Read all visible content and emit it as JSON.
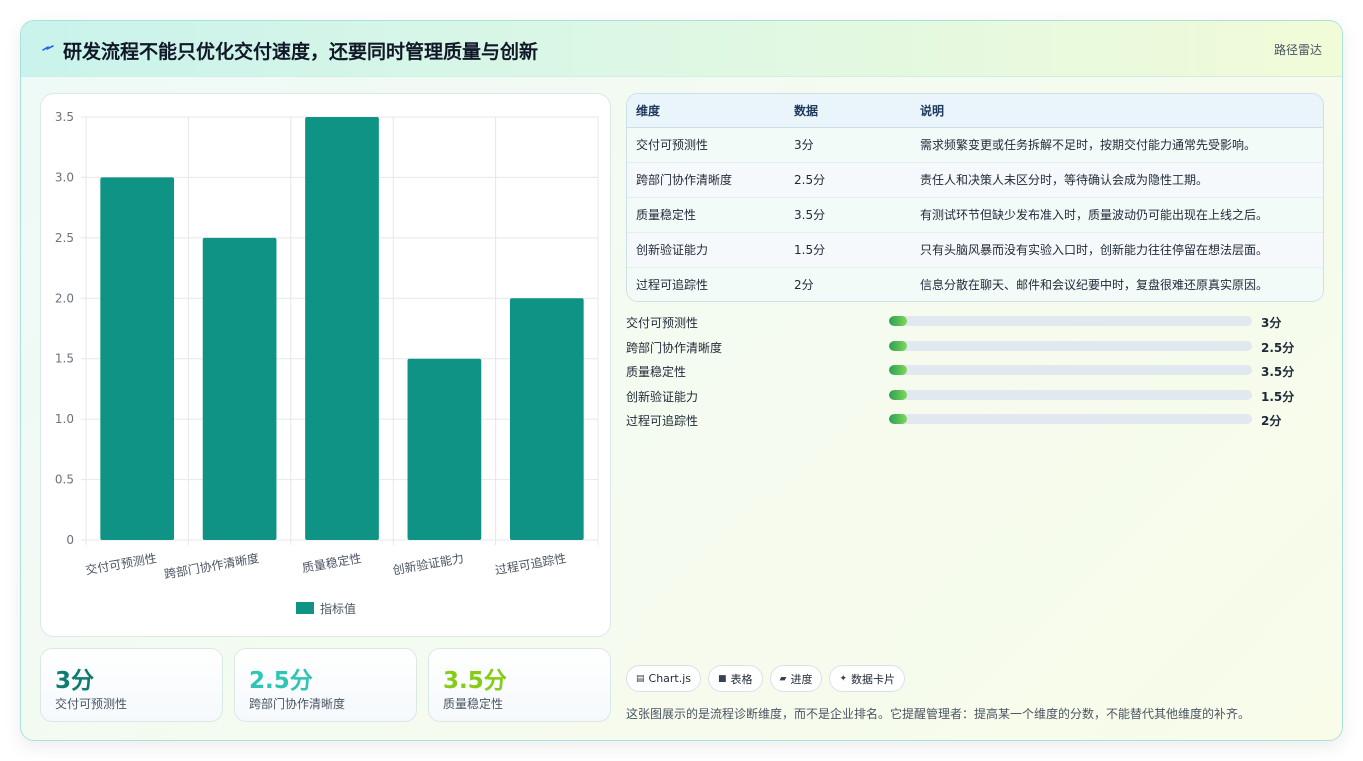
{
  "header": {
    "title": "研发流程不能只优化交付速度，还要同时管理质量与创新",
    "tag": "路径雷达"
  },
  "chart_data": {
    "type": "bar",
    "categories": [
      "交付可预测性",
      "跨部门协作清晰度",
      "质量稳定性",
      "创新验证能力",
      "过程可追踪性"
    ],
    "series": [
      {
        "name": "指标值",
        "values": [
          3,
          2.5,
          3.5,
          1.5,
          2
        ]
      }
    ],
    "ylim": [
      0,
      3.5
    ],
    "yticks": [
      "0",
      "0.5",
      "1.0",
      "1.5",
      "2.0",
      "2.5",
      "3.0",
      "3.5"
    ],
    "legend": "bottom",
    "grid": true,
    "color": "#0e9384"
  },
  "kpis": [
    {
      "value": "3分",
      "label": "交付可预测性",
      "color": "#0e7c6f"
    },
    {
      "value": "2.5分",
      "label": "跨部门协作清晰度",
      "color": "#2ec4b6"
    },
    {
      "value": "3.5分",
      "label": "质量稳定性",
      "color": "#84cc16"
    }
  ],
  "table": {
    "headers": [
      "维度",
      "数据",
      "说明"
    ],
    "rows": [
      [
        "交付可预测性",
        "3分",
        "需求频繁变更或任务拆解不足时，按期交付能力通常先受影响。"
      ],
      [
        "跨部门协作清晰度",
        "2.5分",
        "责任人和决策人未区分时，等待确认会成为隐性工期。"
      ],
      [
        "质量稳定性",
        "3.5分",
        "有测试环节但缺少发布准入时，质量波动仍可能出现在上线之后。"
      ],
      [
        "创新验证能力",
        "1.5分",
        "只有头脑风暴而没有实验入口时，创新能力往往停留在想法层面。"
      ],
      [
        "过程可追踪性",
        "2分",
        "信息分散在聊天、邮件和会议纪要中时，复盘很难还原真实原因。"
      ]
    ]
  },
  "progress": [
    {
      "label": "交付可预测性",
      "value": "3分",
      "fraction": 0.05
    },
    {
      "label": "跨部门协作清晰度",
      "value": "2.5分",
      "fraction": 0.05
    },
    {
      "label": "质量稳定性",
      "value": "3.5分",
      "fraction": 0.05
    },
    {
      "label": "创新验证能力",
      "value": "1.5分",
      "fraction": 0.05
    },
    {
      "label": "过程可追踪性",
      "value": "2分",
      "fraction": 0.05
    }
  ],
  "chips": [
    {
      "icon": "chart-icon",
      "glyph": "▤",
      "label": "Chart.js"
    },
    {
      "icon": "table-icon",
      "glyph": "■",
      "label": "表格"
    },
    {
      "icon": "progress-icon",
      "glyph": "▰",
      "label": "进度"
    },
    {
      "icon": "card-icon",
      "glyph": "✦",
      "label": "数据卡片"
    }
  ],
  "note": "这张图展示的是流程诊断维度，而不是企业排名。它提醒管理者：提高某一个维度的分数，不能替代其他维度的补齐。"
}
